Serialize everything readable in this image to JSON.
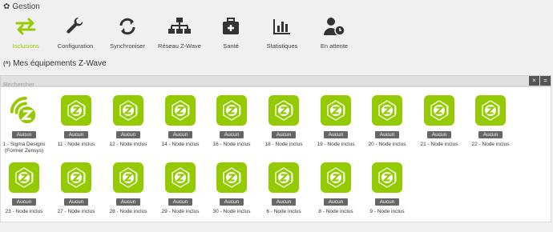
{
  "header": {
    "title": "Gestion",
    "gear_icon": "gear-icon"
  },
  "toolbar": {
    "accent": "#94ca02",
    "items": [
      {
        "label": "Inclusions",
        "icon": "arrows-exchange-icon",
        "active": true
      },
      {
        "label": "Configuration",
        "icon": "wrench-icon",
        "active": false
      },
      {
        "label": "Synchroniser",
        "icon": "refresh-icon",
        "active": false
      },
      {
        "label": "Réseau Z-Wave",
        "icon": "network-icon",
        "active": false
      },
      {
        "label": "Santé",
        "icon": "medkit-icon",
        "active": false
      },
      {
        "label": "Statistiques",
        "icon": "bar-chart-icon",
        "active": false
      },
      {
        "label": "En attente",
        "icon": "user-clock-icon",
        "active": false
      }
    ]
  },
  "equipment": {
    "title": "Mes équipements Z-Wave",
    "search_placeholder": "Rechercher",
    "clear_label": "×",
    "menu_label": "="
  },
  "devices": [
    {
      "badge": "Aucun",
      "name": "1 - Sigma Designs (Former Zensys)",
      "controller": true
    },
    {
      "badge": "Aucun",
      "name": "11 - Node inclus"
    },
    {
      "badge": "Aucun",
      "name": "12 - Node inclus"
    },
    {
      "badge": "Aucun",
      "name": "14 - Node inclus"
    },
    {
      "badge": "Aucun",
      "name": "16 - Node inclus"
    },
    {
      "badge": "Aucun",
      "name": "18 - Node inclus"
    },
    {
      "badge": "Aucun",
      "name": "19 - Node inclus"
    },
    {
      "badge": "Aucun",
      "name": "20 - Node inclus"
    },
    {
      "badge": "Aucun",
      "name": "21 - Node inclus"
    },
    {
      "badge": "Aucun",
      "name": "22 - Node inclus"
    },
    {
      "badge": "Aucun",
      "name": "23 - Node inclus"
    },
    {
      "badge": "Aucun",
      "name": "27 - Node inclus"
    },
    {
      "badge": "Aucun",
      "name": "28 - Node inclus"
    },
    {
      "badge": "Aucun",
      "name": "29 - Node inclus"
    },
    {
      "badge": "Aucun",
      "name": "30 - Node inclus"
    },
    {
      "badge": "Aucun",
      "name": "6 - Node inclus"
    },
    {
      "badge": "Aucun",
      "name": "8 - Node inclus"
    },
    {
      "badge": "Aucun",
      "name": "9 - Node inclus"
    }
  ]
}
